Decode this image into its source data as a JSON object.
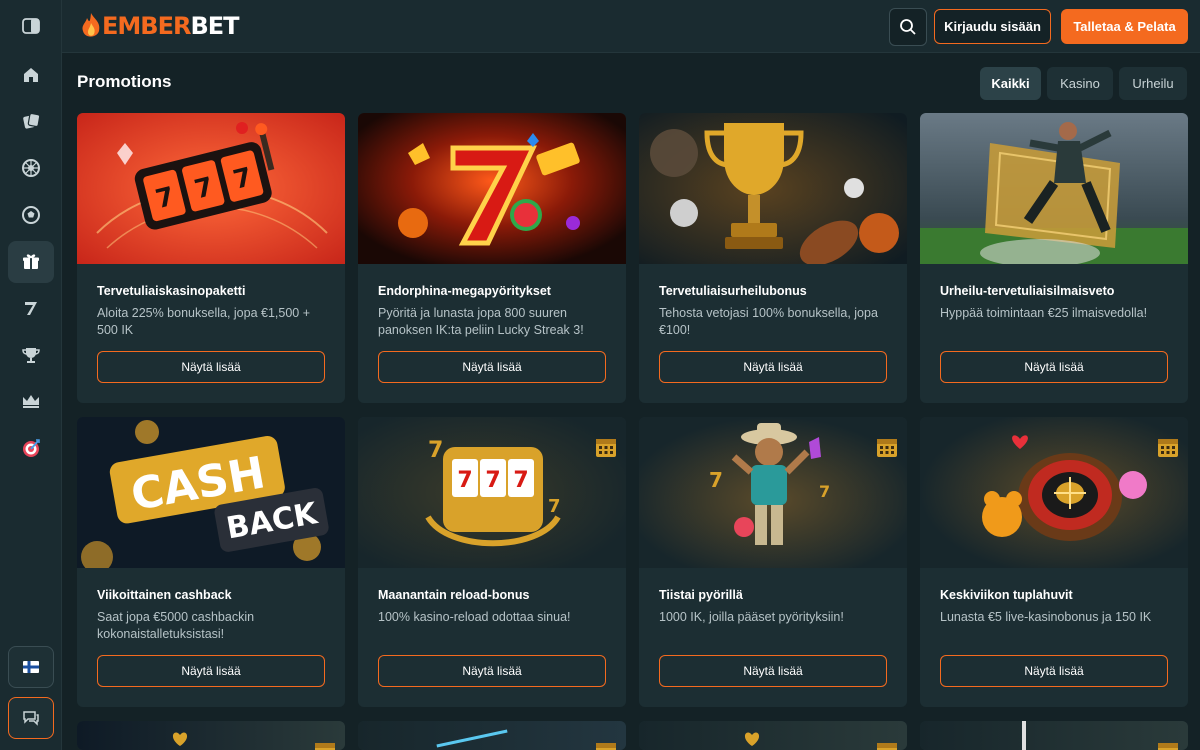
{
  "brand": {
    "name_e": "EMBER",
    "name_rest": "BET"
  },
  "header": {
    "login_label": "Kirjaudu sisään",
    "deposit_label": "Talletaa & Pelata"
  },
  "sidebar": {
    "items": [
      {
        "icon": "collapse-icon"
      },
      {
        "icon": "home-icon"
      },
      {
        "icon": "casino-chips-icon"
      },
      {
        "icon": "roulette-icon"
      },
      {
        "icon": "sports-ball-icon"
      },
      {
        "icon": "gift-icon",
        "active": true
      },
      {
        "icon": "seven-icon"
      },
      {
        "icon": "trophy-icon"
      },
      {
        "icon": "crown-icon"
      },
      {
        "icon": "target-icon"
      }
    ],
    "language_icon": "finland-flag-icon",
    "chat_icon": "chat-icon"
  },
  "page": {
    "title": "Promotions"
  },
  "filters": [
    {
      "label": "Kaikki",
      "active": true
    },
    {
      "label": "Kasino",
      "active": false
    },
    {
      "label": "Urheilu",
      "active": false
    }
  ],
  "cards": [
    {
      "title": "Tervetuliaiskasinopaketti",
      "desc": "Aloita 225% bonuksella, jopa €1,500 + 500 IK",
      "button": "Näytä lisää"
    },
    {
      "title": "Endorphina-megapyöritykset",
      "desc": "Pyöritä ja lunasta jopa 800 suuren panoksen IK:ta peliin Lucky Streak 3!",
      "button": "Näytä lisää"
    },
    {
      "title": "Tervetuliaisurheilubonus",
      "desc": "Tehosta vetojasi 100% bonuksella, jopa €100!",
      "button": "Näytä lisää"
    },
    {
      "title": "Urheilu-tervetuliaisilmaisveto",
      "desc": "Hyppää toimintaan €25 ilmaisvedolla!",
      "button": "Näytä lisää"
    },
    {
      "title": "Viikoittainen cashback",
      "desc": "Saat jopa €5000 cashbackin kokonaistalletuksistasi!",
      "button": "Näytä lisää"
    },
    {
      "title": "Maanantain reload-bonus",
      "desc": "100% kasino-reload odottaa sinua!",
      "button": "Näytä lisää"
    },
    {
      "title": "Tiistai pyörillä",
      "desc": "1000 IK, joilla pääset pyörityksiin!",
      "button": "Näytä lisää"
    },
    {
      "title": "Keskiviikon tuplahuvit",
      "desc": "Lunasta €5 live-kasinobonus ja 150 IK",
      "button": "Näytä lisää"
    }
  ],
  "image_text": {
    "cash": "CASH",
    "back": "BACK"
  },
  "colors": {
    "accent": "#f46a1f",
    "bg": "#142226",
    "card": "#1c2e33"
  }
}
